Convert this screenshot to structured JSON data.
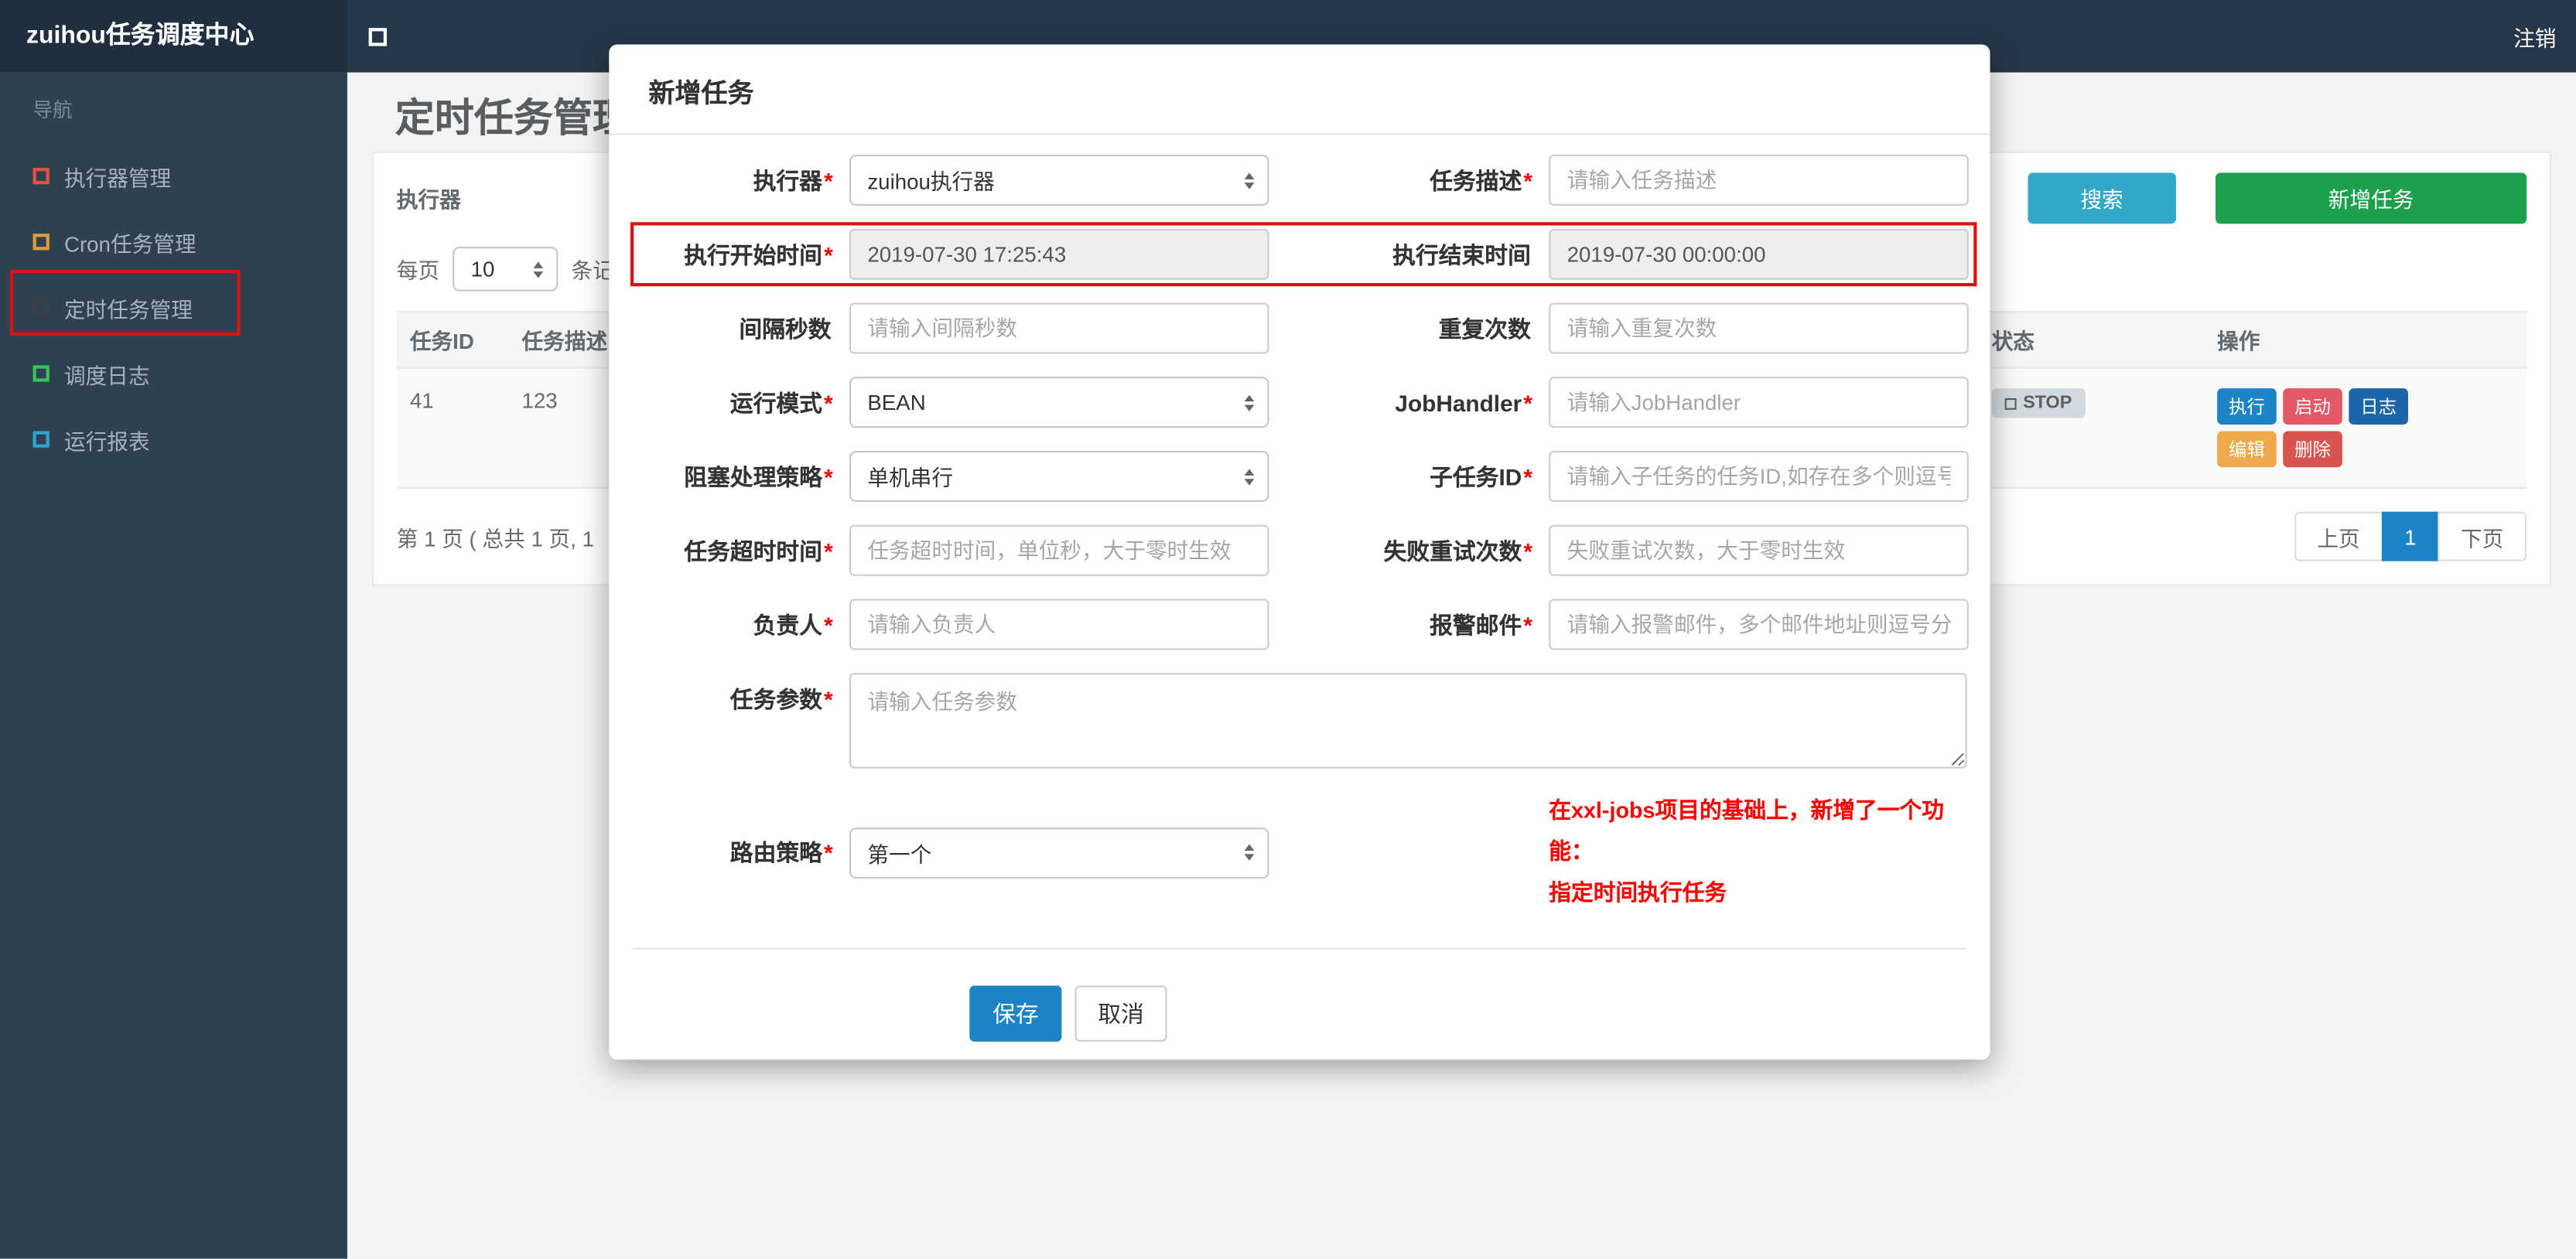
{
  "colors": {
    "topbar_bg": "#26374a",
    "sidebar_bg": "#2f4050",
    "primary_button": "#1c84c6",
    "search_button": "#31a8c9",
    "add_button": "#1ca04c",
    "annotation_red": "#dd1111",
    "note_text": "#ff0000",
    "status_badge_bg": "#d1dade"
  },
  "topbar": {
    "brand": "zuihou任务调度中心",
    "logout": "注销"
  },
  "sidebar": {
    "nav_label": "导航",
    "items": [
      {
        "label": "执行器管理",
        "icon": "square-outline",
        "icon_color": "#e3503e"
      },
      {
        "label": "Cron任务管理",
        "icon": "square-outline",
        "icon_color": "#e09a3c"
      },
      {
        "label": "定时任务管理",
        "icon": "square-outline",
        "icon_color": "#3a3f45",
        "highlighted": true
      },
      {
        "label": "调度日志",
        "icon": "square-outline",
        "icon_color": "#35c256"
      },
      {
        "label": "运行报表",
        "icon": "square-outline",
        "icon_color": "#2ea3cf"
      }
    ]
  },
  "page": {
    "title": "定时任务管理",
    "filter": {
      "executor_label": "执行器",
      "search_button": "搜索",
      "add_button": "新增任务"
    },
    "per_page": {
      "prefix": "每页",
      "value": "10",
      "suffix": "条记录"
    },
    "table": {
      "headers": [
        "任务ID",
        "任务描述",
        "状态",
        "操作"
      ],
      "row": {
        "id": "41",
        "desc": "123",
        "status": "STOP",
        "actions": [
          "执行",
          "启动",
          "日志",
          "编辑",
          "删除"
        ]
      }
    },
    "pagination": {
      "summary": "第 1 页 ( 总共 1 页, 1",
      "prev": "上页",
      "current": "1",
      "next": "下页"
    }
  },
  "modal": {
    "title": "新增任务",
    "save_label": "保存",
    "cancel_label": "取消",
    "note_line1": "在xxl-jobs项目的基础上，新增了一个功能：",
    "note_line2": "指定时间执行任务",
    "fields": {
      "executor": {
        "label": "执行器",
        "required": "*",
        "value": "zuihou执行器"
      },
      "job_desc": {
        "label": "任务描述",
        "required": "*",
        "placeholder": "请输入任务描述"
      },
      "start_time": {
        "label": "执行开始时间",
        "required": "*",
        "value": "2019-07-30 17:25:43"
      },
      "end_time": {
        "label": "执行结束时间",
        "value": "2019-07-30 00:00:00"
      },
      "interval_seconds": {
        "label": "间隔秒数",
        "placeholder": "请输入间隔秒数"
      },
      "repeat_count": {
        "label": "重复次数",
        "placeholder": "请输入重复次数"
      },
      "run_mode": {
        "label": "运行模式",
        "required": "*",
        "value": "BEAN"
      },
      "job_handler": {
        "label": "JobHandler",
        "required": "*",
        "placeholder": "请输入JobHandler"
      },
      "block_strategy": {
        "label": "阻塞处理策略",
        "required": "*",
        "value": "单机串行"
      },
      "child_job_id": {
        "label": "子任务ID",
        "required": "*",
        "placeholder": "请输入子任务的任务ID,如存在多个则逗号分隔"
      },
      "timeout": {
        "label": "任务超时时间",
        "required": "*",
        "placeholder": "任务超时时间，单位秒，大于零时生效"
      },
      "retry_count": {
        "label": "失败重试次数",
        "required": "*",
        "placeholder": "失败重试次数，大于零时生效"
      },
      "owner": {
        "label": "负责人",
        "required": "*",
        "placeholder": "请输入负责人"
      },
      "alarm_email": {
        "label": "报警邮件",
        "required": "*",
        "placeholder": "请输入报警邮件，多个邮件地址则逗号分隔"
      },
      "job_param": {
        "label": "任务参数",
        "required": "*",
        "placeholder": "请输入任务参数"
      },
      "route_strategy": {
        "label": "路由策略",
        "required": "*",
        "value": "第一个"
      }
    }
  }
}
